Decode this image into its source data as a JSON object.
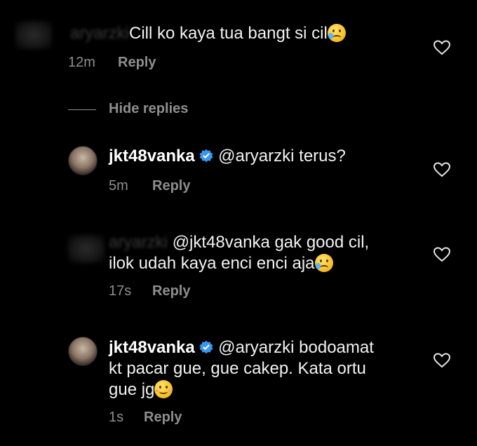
{
  "comments": [
    {
      "text": "Cill ko kaya tua bangt si cil",
      "time": "12m",
      "reply_label": "Reply",
      "emoji": "sad-tear-emoji"
    },
    {
      "username": "jkt48vanka",
      "text": " @aryarzki terus?",
      "time": "5m",
      "reply_label": "Reply"
    },
    {
      "username_obscured": "aryarzki",
      "text_line1": "@jkt48vanka gak good cil,",
      "text_line2": "ilok udah kaya enci enci aja",
      "time": "17s",
      "reply_label": "Reply",
      "emoji": "sad-tear-emoji"
    },
    {
      "username": "jkt48vanka",
      "text_line1": " @aryarzki bodoamat",
      "text_line2": "kt pacar gue, gue cakep. Kata ortu",
      "text_line3": "gue jg",
      "time": "1s",
      "reply_label": "Reply",
      "emoji": "smiling-emoji"
    }
  ],
  "hide_replies_label": "Hide replies",
  "colors": {
    "background": "#000000",
    "text": "#f2f2f2",
    "meta": "#8e8e8e",
    "verified": "#3897f0"
  }
}
